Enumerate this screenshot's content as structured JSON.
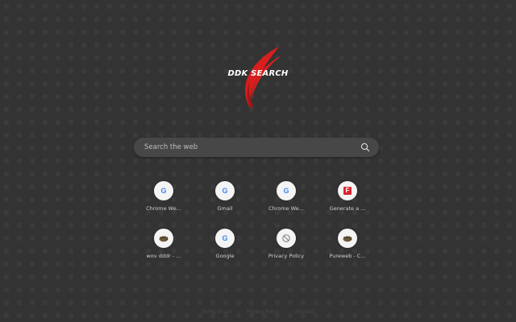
{
  "logo": {
    "text": "DDK SEARCH",
    "accent_color": "#d81e1e"
  },
  "search": {
    "placeholder": "Search the web"
  },
  "shortcuts": [
    {
      "label": "Chrome We...",
      "icon": "google-icon",
      "glyph": "G"
    },
    {
      "label": "Gmail",
      "icon": "google-icon",
      "glyph": "G"
    },
    {
      "label": "Chrome We...",
      "icon": "google-icon",
      "glyph": "G"
    },
    {
      "label": "Generate a ...",
      "icon": "f-logo-icon",
      "glyph": "F"
    },
    {
      "label": "wov dddr - ...",
      "icon": "hedgehog-icon",
      "glyph": ""
    },
    {
      "label": "Google",
      "icon": "google-icon",
      "glyph": "G"
    },
    {
      "label": "Privacy Policy",
      "icon": "privacy-icon",
      "glyph": ""
    },
    {
      "label": "Pureweb - C...",
      "icon": "hedgehog-icon",
      "glyph": ""
    }
  ],
  "footer": {
    "links": [
      "Terms of use",
      "Privacy Policy",
      "Uninstall"
    ]
  }
}
